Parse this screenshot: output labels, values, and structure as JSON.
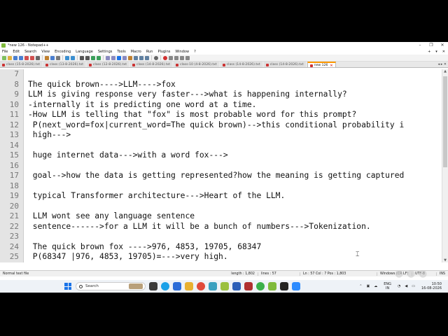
{
  "window": {
    "title": "*new 126 - Notepad++",
    "controls": [
      "–",
      "❐",
      "✕"
    ]
  },
  "menu": [
    "File",
    "Edit",
    "Search",
    "View",
    "Encoding",
    "Language",
    "Settings",
    "Tools",
    "Macro",
    "Run",
    "Plugins",
    "Window",
    "?"
  ],
  "menu_right": [
    "+",
    "▾",
    "✕"
  ],
  "tabs": [
    {
      "label": "class (15-8-2026).txt",
      "active": false
    },
    {
      "label": "class (13-8-2026).txt",
      "active": false
    },
    {
      "label": "class (12-8-2026).txt",
      "active": false
    },
    {
      "label": "class (14-8-2026).txt",
      "active": false
    },
    {
      "label": "class-10 (4-8-2026).txt",
      "active": false
    },
    {
      "label": "class (14-8-2026).txt",
      "active": false
    },
    {
      "label": "class (14-8-2026).txt",
      "active": false
    },
    {
      "label": "new 126",
      "active": true
    }
  ],
  "tab_arrows": "◂ ▸ ✕",
  "editor": {
    "line_numbers": [
      "7",
      "8",
      "9",
      "10",
      "11",
      "12",
      "13",
      "14",
      "15",
      "16",
      "17",
      "18",
      "19",
      "20",
      "21",
      "22",
      "23",
      "24",
      "25"
    ],
    "lines": [
      "",
      "The quick brown---->LLM---->fox",
      "LLM is giving response very faster--->what is happening internally?",
      "-internally it is predicting one word at a time.",
      "-How LLM is telling that \"fox\" is most probable word for this prompt?",
      " P(next_word=fox|current_word=The quick brown)-->this conditional probability i",
      " high--->",
      "",
      " huge internet data--->with a word fox--->",
      "",
      " goal-->how the data is getting represented?how the meaning is getting captured",
      "",
      " typical Transformer architecture--->Heart of the LLM.",
      "",
      " LLM wont see any language sentence",
      " sentence------>for a LLM it will be a bunch of numbers--->Tokenization.",
      "",
      " The quick brown fox ---->976, 4853, 19705, 68347",
      " P(68347 |976, 4853, 19705)=--->very high."
    ]
  },
  "status": {
    "file_type": "Normal text file",
    "length": "length : 1,802",
    "lines": "lines : 57",
    "position": "Ln : 57    Col : 7    Pos : 1,803",
    "eol": "Windows (CR LF)",
    "encoding": "UTF-8",
    "mode": "INS"
  },
  "taskbar": {
    "search_placeholder": "Search",
    "language": "ENG",
    "region": "IN",
    "time": "10:50",
    "date": "16-08-2026"
  },
  "colors": {
    "accent_tab": "#ff9900",
    "windows_blue": "#1a73e8"
  }
}
